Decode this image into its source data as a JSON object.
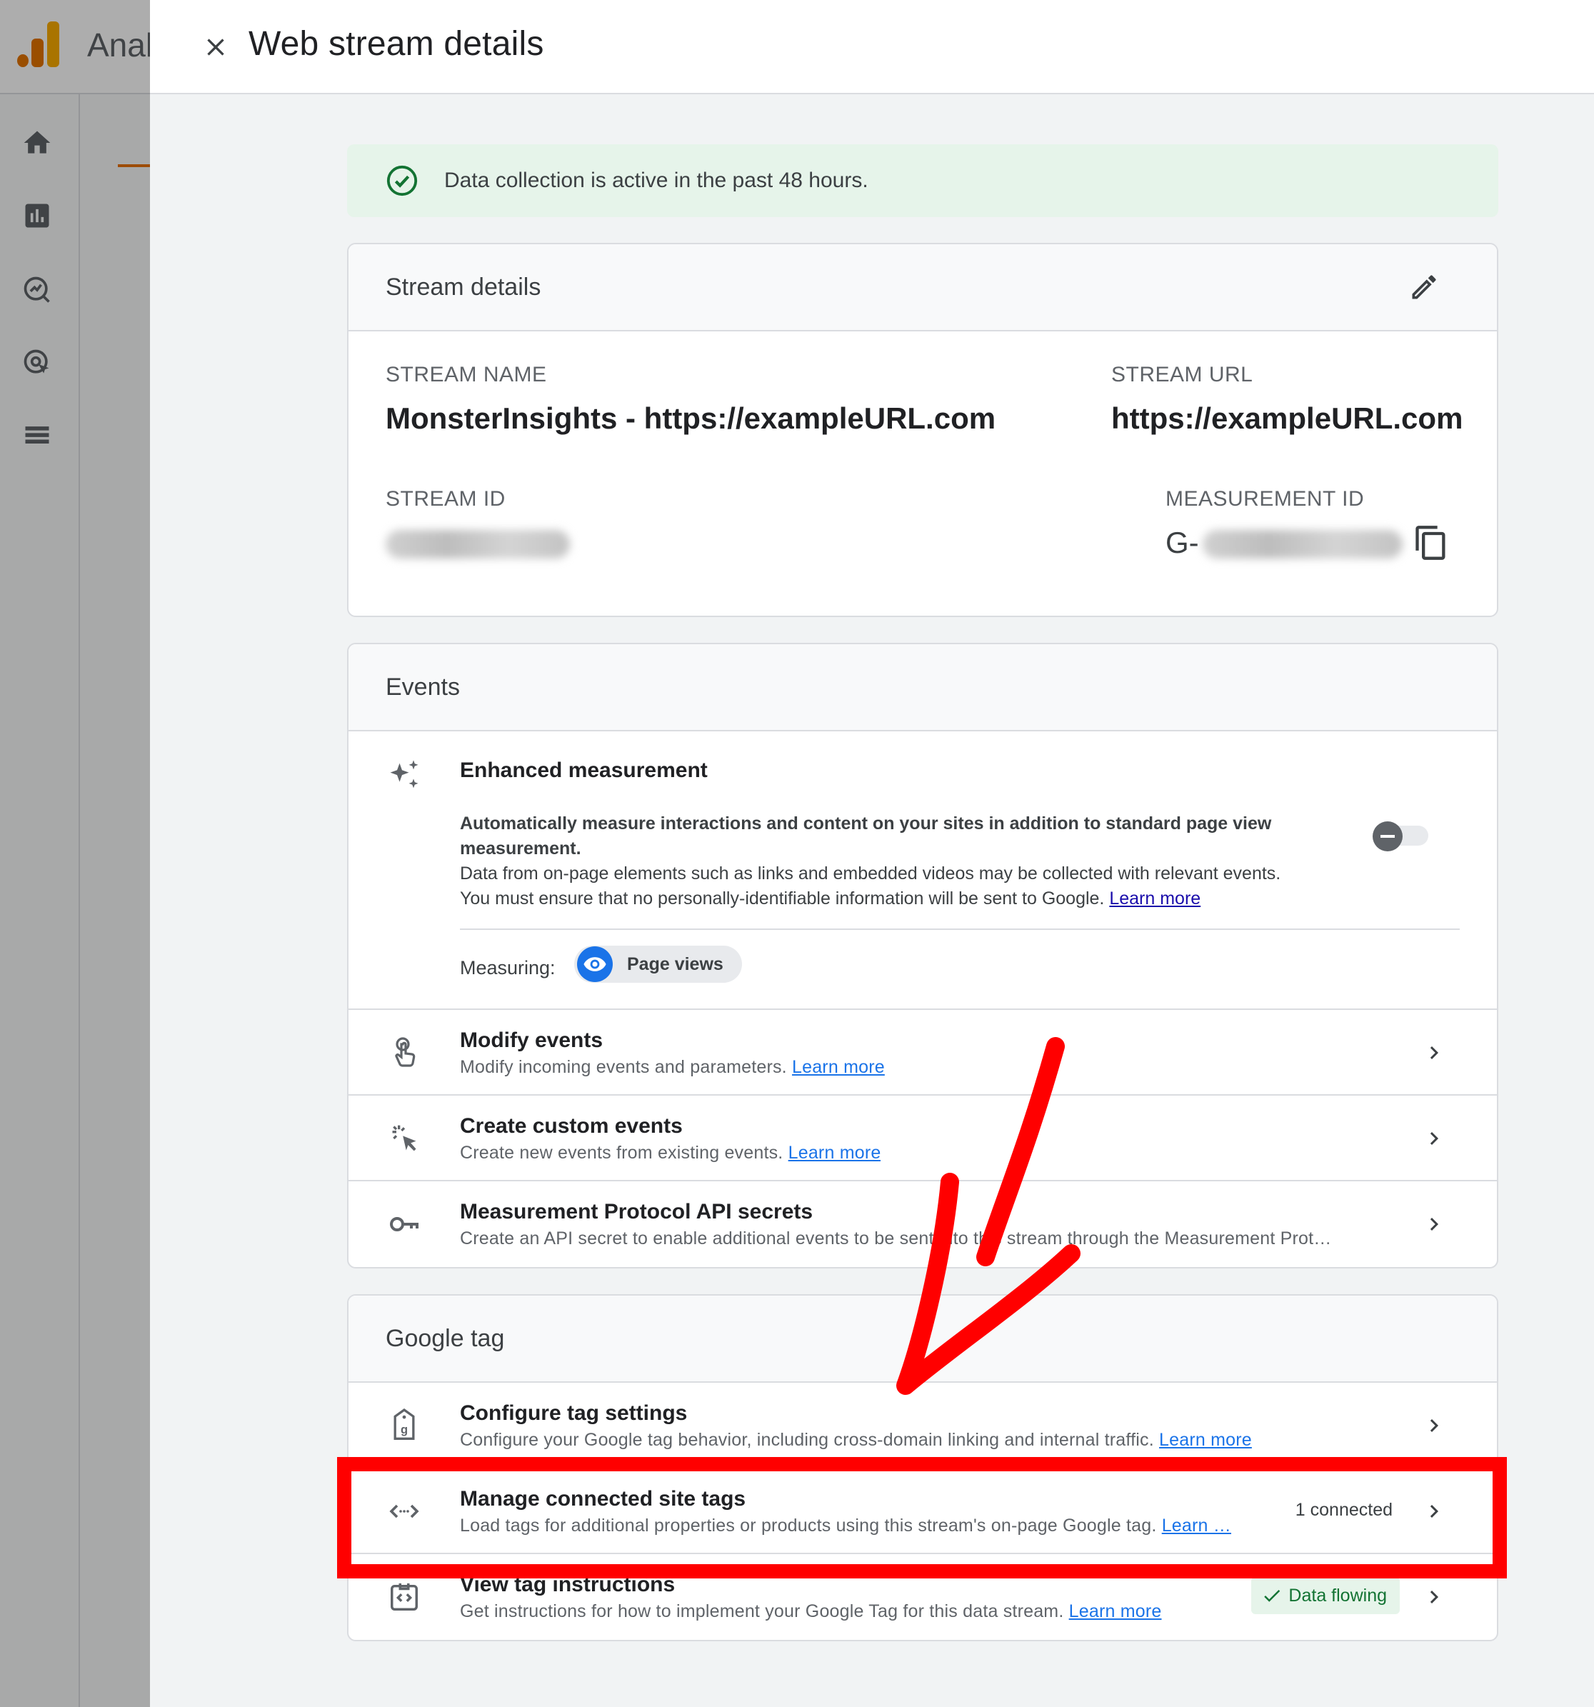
{
  "app": {
    "name": "Anal"
  },
  "sheet": {
    "title": "Web stream details"
  },
  "banner": {
    "text": "Data collection is active in the past 48 hours."
  },
  "stream_details": {
    "header": "Stream details",
    "stream_name_label": "STREAM NAME",
    "stream_name": "MonsterInsights - https://exampleURL.com",
    "stream_url_label": "STREAM URL",
    "stream_url": "https://exampleURL.com",
    "stream_id_label": "STREAM ID",
    "measurement_id_label": "MEASUREMENT ID",
    "measurement_id_prefix": "G-"
  },
  "events": {
    "header": "Events",
    "enhanced": {
      "title": "Enhanced measurement",
      "desc_bold": "Automatically measure interactions and content on your sites in addition to standard page view measurement.",
      "desc_line1": "Data from on-page elements such as links and embedded videos may be collected with relevant events.",
      "desc_line2": "You must ensure that no personally-identifiable information will be sent to Google.",
      "learn_more": "Learn more",
      "measuring_label": "Measuring:",
      "chip_label": "Page views"
    },
    "rows": [
      {
        "title": "Modify events",
        "sub": "Modify incoming events and parameters.",
        "link": "Learn more"
      },
      {
        "title": "Create custom events",
        "sub": "Create new events from existing events.",
        "link": "Learn more"
      },
      {
        "title": "Measurement Protocol API secrets",
        "sub": "Create an API secret to enable additional events to be sent into this stream through the Measurement Prot…"
      }
    ]
  },
  "google_tag": {
    "header": "Google tag",
    "rows": [
      {
        "title": "Configure tag settings",
        "sub": "Configure your Google tag behavior, including cross-domain linking and internal traffic.",
        "link": "Learn more"
      },
      {
        "title": "Manage connected site tags",
        "sub": "Load tags for additional properties or products using this stream's on-page Google tag.",
        "link": "Learn …",
        "meta": "1 connected"
      },
      {
        "title": "View tag instructions",
        "sub": "Get instructions for how to implement your Google Tag for this data stream.",
        "link": "Learn more",
        "badge": "Data flowing"
      }
    ]
  },
  "colors": {
    "accent": "#1a73e8",
    "success": "#137333",
    "annotation": "#ff0000",
    "logo": "#f9ab00"
  }
}
